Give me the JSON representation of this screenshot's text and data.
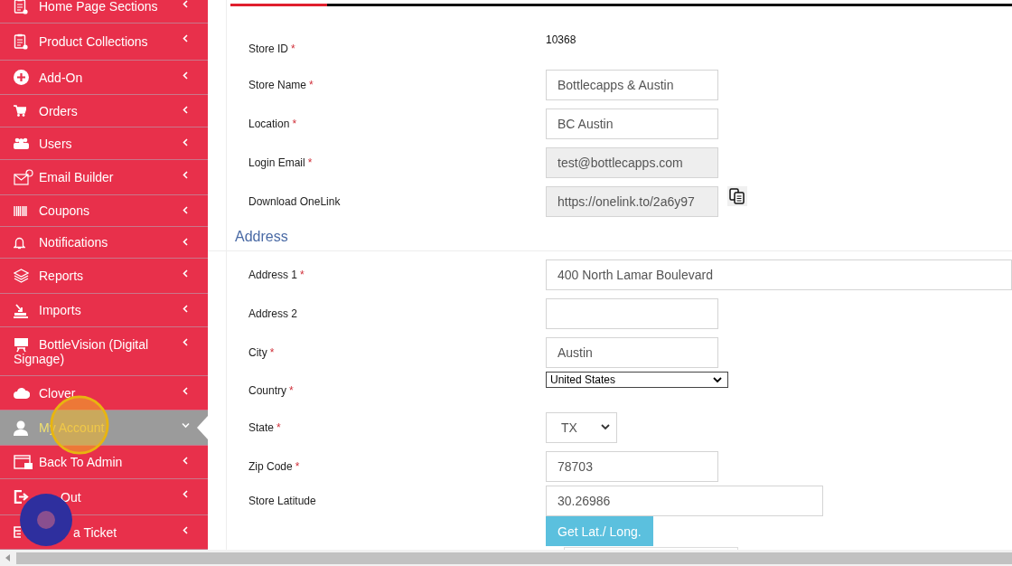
{
  "sidebar": {
    "items": [
      {
        "label": "Home Page Sections",
        "selected": false,
        "expanded": false
      },
      {
        "label": "Product Collections",
        "selected": false,
        "expanded": false
      },
      {
        "label": "Add-On",
        "selected": false,
        "expanded": false
      },
      {
        "label": "Orders",
        "selected": false,
        "expanded": false
      },
      {
        "label": "Users",
        "selected": false,
        "expanded": false
      },
      {
        "label": "Email Builder",
        "selected": false,
        "expanded": false
      },
      {
        "label": "Coupons",
        "selected": false,
        "expanded": false
      },
      {
        "label": "Notifications",
        "selected": false,
        "expanded": false
      },
      {
        "label": "Reports",
        "selected": false,
        "expanded": false
      },
      {
        "label": "Imports",
        "selected": false,
        "expanded": false
      },
      {
        "label": "BottleVision (Digital Signage)",
        "selected": false,
        "expanded": false
      },
      {
        "label": "Clover",
        "selected": false,
        "expanded": false
      },
      {
        "label": "My Account",
        "selected": true,
        "expanded": true
      },
      {
        "label": "Back To Admin",
        "selected": false,
        "expanded": false
      },
      {
        "label": "Out",
        "selected": false,
        "expanded": false
      },
      {
        "label": "a Ticket",
        "selected": false,
        "expanded": false
      }
    ]
  },
  "form": {
    "sections": [
      {
        "fields": [
          {
            "label": "Store ID",
            "required": "*",
            "kind": "static",
            "value": "10368"
          },
          {
            "label": "Store Name",
            "required": "*",
            "kind": "input",
            "value": "Bottlecapps & Austin"
          },
          {
            "label": "Location",
            "required": "*",
            "kind": "input",
            "value": "BC Austin"
          },
          {
            "label": "Login Email",
            "required": "*",
            "kind": "readonly",
            "value": "test@bottlecapps.com"
          },
          {
            "label": "Download OneLink",
            "kind": "copy",
            "value": "https://onelink.to/2a6y97"
          }
        ]
      },
      {
        "title": "Address",
        "fields": [
          {
            "label": "Address 1",
            "required": "*",
            "kind": "input",
            "value": "400 North Lamar Boulevard"
          },
          {
            "label": "Address 2",
            "kind": "input"
          },
          {
            "label": "City",
            "required": "*",
            "kind": "input",
            "value": "Austin"
          },
          {
            "label": "Country",
            "required": "*",
            "kind": "select",
            "value": "United States"
          },
          {
            "label": "State",
            "required": "*",
            "kind": "dropdown",
            "value": "TX"
          },
          {
            "label": "Zip Code",
            "required": "*",
            "kind": "input",
            "value": "78703"
          },
          {
            "label": "Store Latitude",
            "kind": "input",
            "value": "30.26986",
            "button": "Get Lat./ Long."
          }
        ]
      }
    ]
  }
}
